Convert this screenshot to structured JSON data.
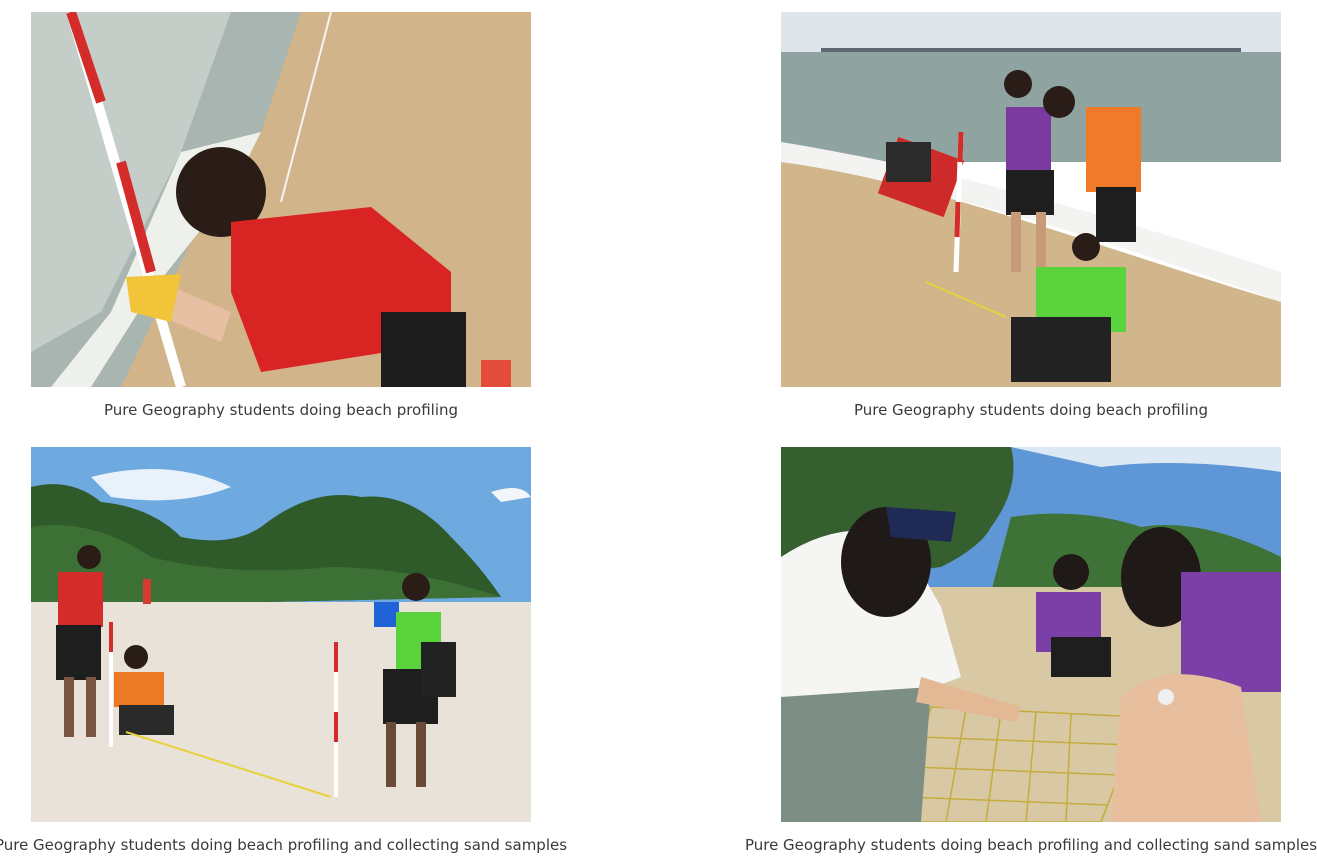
{
  "gallery": {
    "items": [
      {
        "caption": "Pure Geography students doing beach profiling",
        "image": "beach-profiling-photo"
      },
      {
        "caption": "Pure Geography students doing beach profiling",
        "image": "beach-profiling-photo"
      },
      {
        "caption": "Pure Geography students doing beach profiling and collecting sand samples",
        "image": "beach-profiling-photo"
      },
      {
        "caption": "Pure Geography students doing beach profiling and collecting sand samples",
        "image": "sand-sampling-photo"
      }
    ]
  },
  "colors": {
    "sand": "#d8b98a",
    "sea": "#a9b9b5",
    "sky": "#6fa6dd",
    "foliage": "#2f5a2a",
    "caption_text": "#3a3a3a"
  }
}
